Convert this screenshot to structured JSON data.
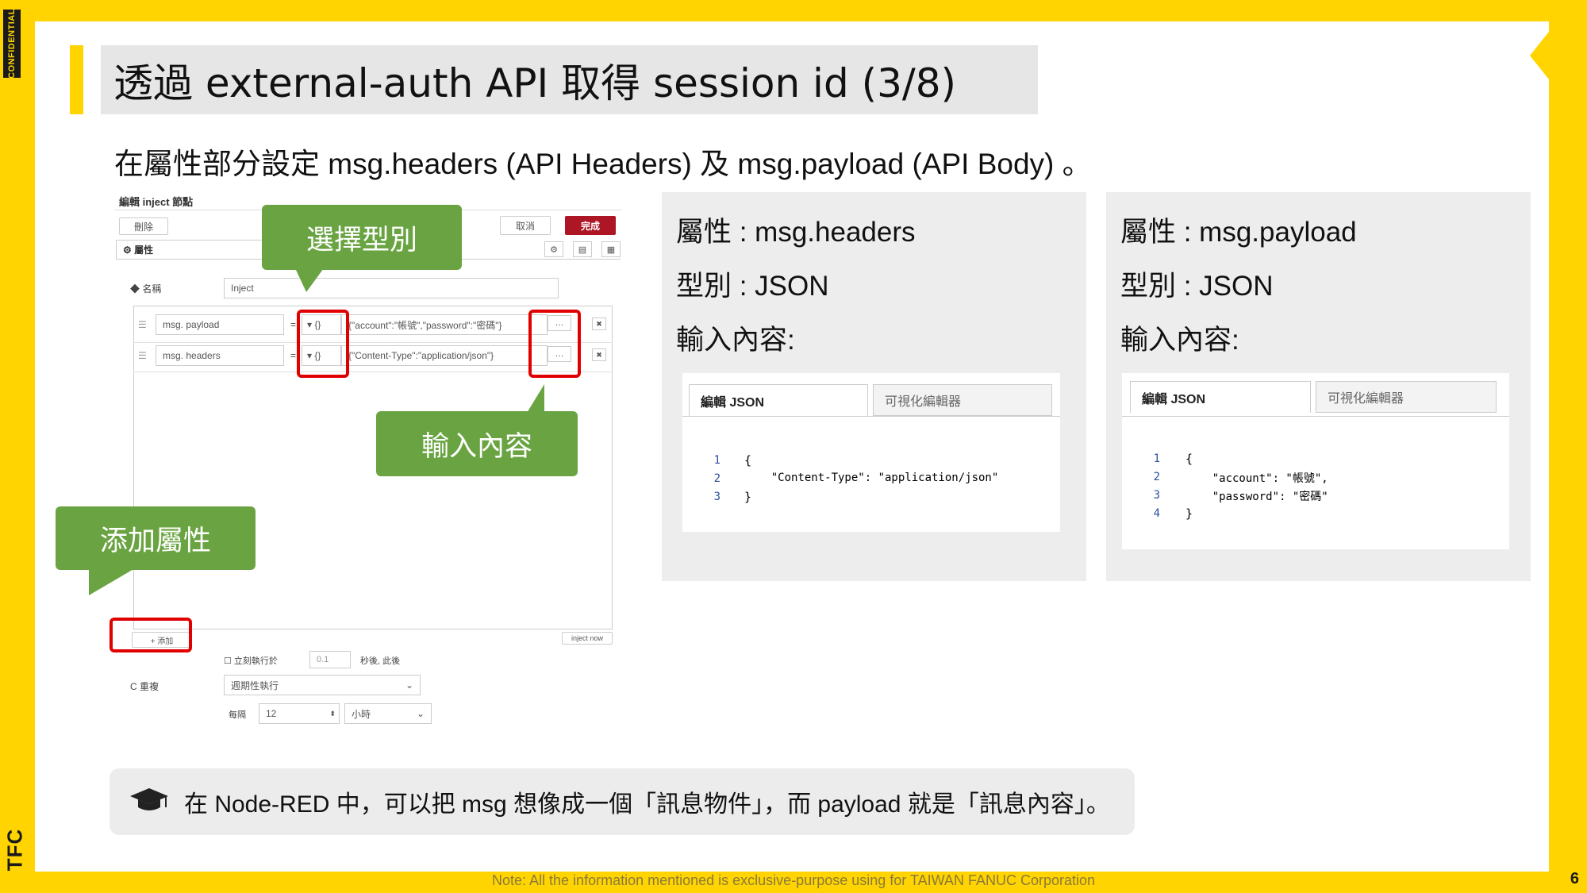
{
  "badge": "CONFIDENTIAL",
  "logo": "TFC",
  "title": "透過 external-auth API 取得 session id (3/8)",
  "subtitle": "在屬性部分設定 msg.headers (API Headers) 及 msg.payload (API Body) 。",
  "editor": {
    "header": "編輯 inject 節點",
    "delete_label": "刪除",
    "cancel_label": "取消",
    "done_label": "完成",
    "tab_label": "⚙ 屬性",
    "name_label": "◆ 名稱",
    "name_value": "Inject",
    "props": [
      {
        "prefix": "msg.",
        "key": "payload",
        "type": "{}",
        "value": "{\"account\":\"帳號\",\"password\":\"密碼\"}"
      },
      {
        "prefix": "msg.",
        "key": "headers",
        "type": "{}",
        "value": "{\"Content-Type\":\"application/json\"}"
      }
    ],
    "add_label": "+ 添加",
    "inject_now_label": "inject now",
    "once_label": "☐ 立刻執行於",
    "once_value": "0.1",
    "once_suffix": "秒後, 此後",
    "repeat_label": "C 重複",
    "repeat_value": "週期性執行",
    "every_label": "每隔",
    "every_value": "12",
    "unit_value": "小時"
  },
  "callouts": {
    "select_type": "選擇型別",
    "input_content": "輸入內容",
    "add_property": "添加屬性"
  },
  "panels": [
    {
      "property": "屬性 : msg.headers",
      "type": "型別 : JSON",
      "content_label": "輸入內容:",
      "tab_edit": "編輯 JSON",
      "tab_visual": "可視化編輯器",
      "line_numbers": [
        "1",
        "2",
        "3"
      ],
      "code_lines": [
        "{",
        "    \"Content-Type\": \"application/json\"",
        "}"
      ]
    },
    {
      "property": "屬性 : msg.payload",
      "type": "型別 : JSON",
      "content_label": "輸入內容:",
      "tab_edit": "編輯 JSON",
      "tab_visual": "可視化編輯器",
      "line_numbers": [
        "1",
        "2",
        "3",
        "4"
      ],
      "code_lines": [
        "{",
        "    \"account\": \"帳號\",",
        "    \"password\": \"密碼\"",
        "}"
      ]
    }
  ],
  "note": "在 Node-RED 中，可以把 msg 想像成一個「訊息物件」，而 payload 就是「訊息內容」。",
  "footer": "Note: All the information mentioned is exclusive-purpose using for TAIWAN FANUC Corporation",
  "page_number": "6"
}
